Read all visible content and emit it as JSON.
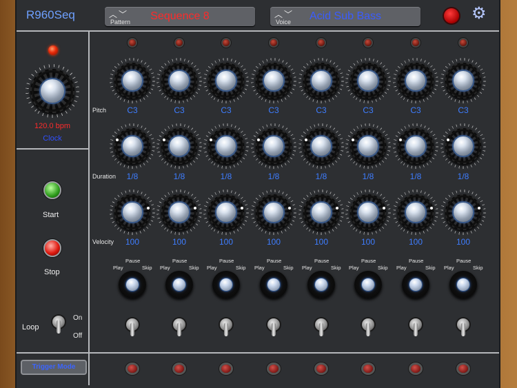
{
  "header": {
    "app_title": "R960Seq",
    "pattern": {
      "label": "Pattern",
      "value": "Sequence 8",
      "arrows": "︿﹀",
      "value_color": "#ff2a2a"
    },
    "voice": {
      "label": "Voice",
      "value": "Acid Sub Bass",
      "arrows": "︿﹀",
      "value_color": "#3a5cff"
    },
    "power_icon": "power-icon",
    "settings_icon": "gear-icon"
  },
  "clock": {
    "bpm": "120.0 bpm",
    "label": "Clock"
  },
  "transport": {
    "start_label": "Start",
    "stop_label": "Stop"
  },
  "loop": {
    "label": "Loop",
    "on_label": "On",
    "off_label": "Off"
  },
  "trigger_mode_label": "Trigger Mode",
  "rows": {
    "pitch": "Pitch",
    "duration": "Duration",
    "velocity": "Velocity"
  },
  "mode_labels": {
    "play": "Play",
    "pause": "Pause",
    "skip": "Skip"
  },
  "steps": [
    {
      "pitch": "C3",
      "duration": "1/8",
      "velocity": "100"
    },
    {
      "pitch": "C3",
      "duration": "1/8",
      "velocity": "100"
    },
    {
      "pitch": "C3",
      "duration": "1/8",
      "velocity": "100"
    },
    {
      "pitch": "C3",
      "duration": "1/8",
      "velocity": "100"
    },
    {
      "pitch": "C3",
      "duration": "1/8",
      "velocity": "100"
    },
    {
      "pitch": "C3",
      "duration": "1/8",
      "velocity": "100"
    },
    {
      "pitch": "C3",
      "duration": "1/8",
      "velocity": "100"
    },
    {
      "pitch": "C3",
      "duration": "1/8",
      "velocity": "100"
    }
  ],
  "colors": {
    "accent_blue": "#3e7dff",
    "led_red": "#e82a0a",
    "panel": "#2d2f32"
  }
}
